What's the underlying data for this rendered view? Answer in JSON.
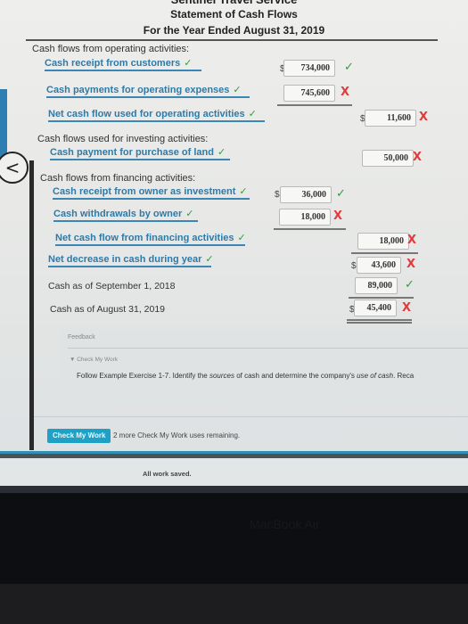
{
  "header": {
    "company": "Sentinel Travel Service",
    "title": "Statement of Cash Flows",
    "period": "For the Year Ended August 31, 2019"
  },
  "operating": {
    "heading": "Cash flows from operating activities:",
    "receipts_label": "Cash receipt from customers",
    "receipts_amount": "734,000",
    "receipts_status": "correct",
    "payments_label": "Cash payments for operating expenses",
    "payments_amount": "745,600",
    "payments_status": "incorrect",
    "net_label": "Net cash flow used for operating activities",
    "net_amount": "11,600",
    "net_status": "incorrect"
  },
  "investing": {
    "heading": "Cash flows used for investing activities:",
    "land_label": "Cash payment for purchase of land",
    "land_amount": "50,000",
    "land_status": "incorrect"
  },
  "financing": {
    "heading": "Cash flows from financing activities:",
    "investment_label": "Cash receipt from owner as investment",
    "investment_amount": "36,000",
    "investment_status": "correct",
    "withdrawals_label": "Cash withdrawals by owner",
    "withdrawals_amount": "18,000",
    "withdrawals_status": "incorrect",
    "net_label": "Net cash flow from financing activities",
    "net_amount": "18,000",
    "net_status": "incorrect"
  },
  "summary": {
    "decrease_label": "Net decrease in cash during year",
    "decrease_amount": "43,600",
    "decrease_status": "incorrect",
    "begin_label": "Cash as of September 1, 2018",
    "begin_amount": "89,000",
    "begin_status": "correct",
    "end_label": "Cash as of August 31, 2019",
    "end_amount": "45,400",
    "end_status": "incorrect"
  },
  "symbols": {
    "dollar": "$",
    "check": "✓",
    "cross": "X",
    "back": "<"
  },
  "feedback": {
    "title": "Feedback",
    "toggle": "▼ Check My Work",
    "text_1": "Follow Example Exercise 1-7. Identify the ",
    "text_em_1": "sources",
    "text_2": " of cash and determine the company's ",
    "text_em_2": "use of cash",
    "text_3": ". Reca"
  },
  "footer": {
    "check_button": "Check My Work",
    "remaining": "2 more Check My Work uses remaining.",
    "saved": "All work saved."
  },
  "bezel": {
    "brand": "MacBook Air"
  },
  "colors": {
    "label_blue": "#2e7aa8",
    "correct_green": "#2e9e3a",
    "incorrect_red": "#e23b3b",
    "button_teal": "#1fa1c6"
  }
}
